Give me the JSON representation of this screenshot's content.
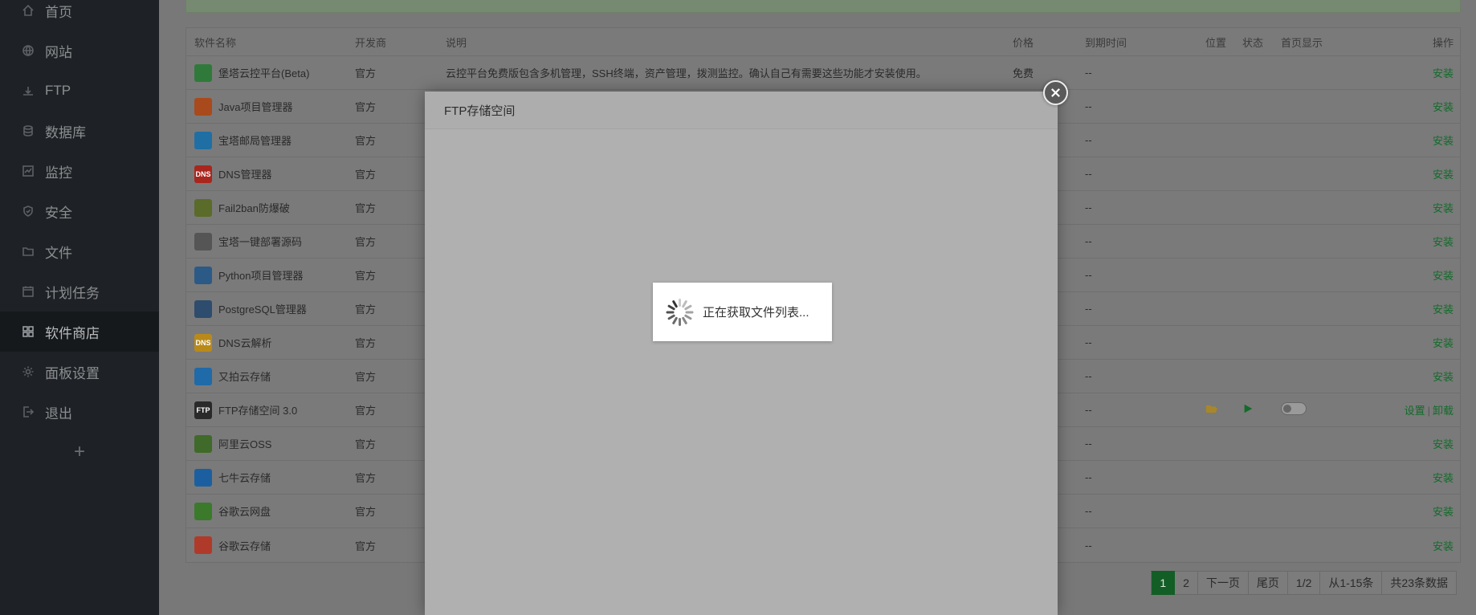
{
  "sidebar": {
    "items": [
      {
        "label": "首页",
        "icon": "home-icon"
      },
      {
        "label": "网站",
        "icon": "globe-icon"
      },
      {
        "label": "FTP",
        "icon": "ftp-icon"
      },
      {
        "label": "数据库",
        "icon": "database-icon"
      },
      {
        "label": "监控",
        "icon": "monitor-icon"
      },
      {
        "label": "安全",
        "icon": "shield-icon"
      },
      {
        "label": "文件",
        "icon": "folder-icon"
      },
      {
        "label": "计划任务",
        "icon": "calendar-icon"
      },
      {
        "label": "软件商店",
        "icon": "grid-icon",
        "active": true
      },
      {
        "label": "面板设置",
        "icon": "gear-icon"
      },
      {
        "label": "退出",
        "icon": "logout-icon"
      }
    ],
    "add_label": "+"
  },
  "table": {
    "headers": {
      "name": "软件名称",
      "developer": "开发商",
      "description": "说明",
      "price": "价格",
      "expiry": "到期时间",
      "position": "位置",
      "status": "状态",
      "home_display": "首页显示",
      "action": "操作"
    },
    "rows": [
      {
        "name": "堡塔云控平台(Beta)",
        "dev": "官方",
        "desc": "云控平台免费版包含多机管理，SSH终端，资产管理，拨测监控。确认自己有需要这些功能才安装使用。",
        "price": "免费",
        "exp": "--",
        "action": "安装",
        "icon": "bt-cloud-icon",
        "color": "#2f7a3a"
      },
      {
        "name": "Java项目管理器",
        "dev": "官方",
        "desc": "",
        "price": "",
        "exp": "--",
        "action": "安装",
        "icon": "java-icon",
        "color": "#a94a1c"
      },
      {
        "name": "宝塔邮局管理器",
        "dev": "官方",
        "desc": "",
        "price": "",
        "exp": "--",
        "action": "安装",
        "icon": "mail-icon",
        "color": "#1f6fa4"
      },
      {
        "name": "DNS管理器",
        "dev": "官方",
        "desc": "",
        "price": "",
        "exp": "--",
        "action": "安装",
        "icon": "dns-icon",
        "color": "#a8261e"
      },
      {
        "name": "Fail2ban防爆破",
        "dev": "官方",
        "desc": "",
        "price": "",
        "exp": "--",
        "action": "安装",
        "icon": "fail2ban-icon",
        "color": "#5a6b2a"
      },
      {
        "name": "宝塔一键部署源码",
        "dev": "官方",
        "desc": "",
        "price": "",
        "exp": "--",
        "action": "安装",
        "icon": "code-icon",
        "color": "#555555"
      },
      {
        "name": "Python项目管理器",
        "dev": "官方",
        "desc": "",
        "price": "",
        "exp": "--",
        "action": "安装",
        "icon": "python-icon",
        "color": "#2b5a86"
      },
      {
        "name": "PostgreSQL管理器",
        "dev": "官方",
        "desc": "",
        "price": "",
        "exp": "--",
        "action": "安装",
        "icon": "postgresql-icon",
        "color": "#2d4c6e"
      },
      {
        "name": "DNS云解析",
        "dev": "官方",
        "desc": "",
        "price": "",
        "exp": "--",
        "action": "安装",
        "icon": "dns-cloud-icon",
        "color": "#b98a1a"
      },
      {
        "name": "又拍云存储",
        "dev": "官方",
        "desc": "",
        "price": "",
        "exp": "--",
        "action": "安装",
        "icon": "upyun-icon",
        "color": "#1f6aa8"
      },
      {
        "name": "FTP存储空间 3.0",
        "dev": "官方",
        "desc": "",
        "price": "",
        "exp": "--",
        "action": "",
        "installed": true,
        "icon": "ftp-cloud-icon",
        "color": "#2a2a2a",
        "op_settings": "设置",
        "op_sep": "|",
        "op_uninstall": "卸载"
      },
      {
        "name": "阿里云OSS",
        "dev": "官方",
        "desc": "",
        "price": "",
        "exp": "--",
        "action": "安装",
        "icon": "aliyun-oss-icon",
        "color": "#3f6a2a"
      },
      {
        "name": "七牛云存储",
        "dev": "官方",
        "desc": "",
        "price": "",
        "exp": "--",
        "action": "安装",
        "icon": "qiniu-icon",
        "color": "#1c5fa0"
      },
      {
        "name": "谷歌云网盘",
        "dev": "官方",
        "desc": "",
        "price": "",
        "exp": "--",
        "action": "安装",
        "icon": "google-drive-icon",
        "color": "#3a7a2a"
      },
      {
        "name": "谷歌云存储",
        "dev": "官方",
        "desc": "",
        "price": "",
        "exp": "--",
        "action": "安装",
        "icon": "google-cloud-icon",
        "color": "#b03a2a"
      }
    ]
  },
  "pagination": {
    "current": "1",
    "page2": "2",
    "next": "下一页",
    "last": "尾页",
    "page_info": "1/2",
    "range": "从1-15条",
    "total": "共23条数据"
  },
  "modal": {
    "title": "FTP存储空间",
    "loading_text": "正在获取文件列表..."
  }
}
